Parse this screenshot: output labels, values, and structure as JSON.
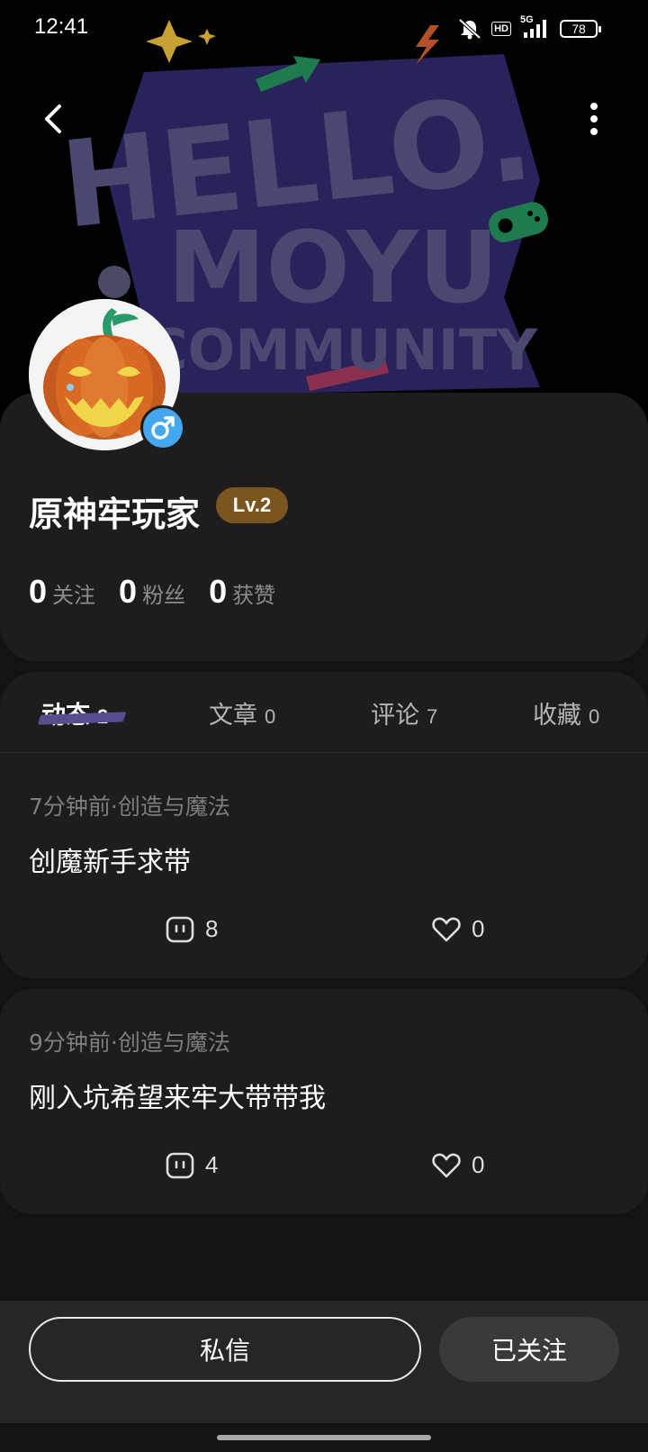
{
  "status_bar": {
    "time": "12:41",
    "network": "5G",
    "hd": "HD",
    "battery": "78"
  },
  "banner": {
    "line1": "HELLO.",
    "line2": "MOYU",
    "line3": "COMMUNITY"
  },
  "profile": {
    "username": "原神牢玩家",
    "level": "Lv.2",
    "gender_icon": "male-icon",
    "stats": [
      {
        "value": "0",
        "label": "关注"
      },
      {
        "value": "0",
        "label": "粉丝"
      },
      {
        "value": "0",
        "label": "获赞"
      }
    ]
  },
  "tabs": [
    {
      "label": "动态",
      "count": "2",
      "active": true
    },
    {
      "label": "文章",
      "count": "0",
      "active": false
    },
    {
      "label": "评论",
      "count": "7",
      "active": false
    },
    {
      "label": "收藏",
      "count": "0",
      "active": false
    }
  ],
  "posts": [
    {
      "meta": "7分钟前·创造与魔法",
      "title": "创魔新手求带",
      "comments": "8",
      "likes": "0"
    },
    {
      "meta": "9分钟前·创造与魔法",
      "title": "刚入坑希望来牢大带带我",
      "comments": "4",
      "likes": "0"
    }
  ],
  "bottom_bar": {
    "message_label": "私信",
    "follow_label": "已关注"
  },
  "colors": {
    "background": "#131313",
    "card": "#1d1d1d",
    "level_badge": "#7a5520",
    "gender_badge": "#44a7f0",
    "tab_underline": "#5a4d8f"
  }
}
